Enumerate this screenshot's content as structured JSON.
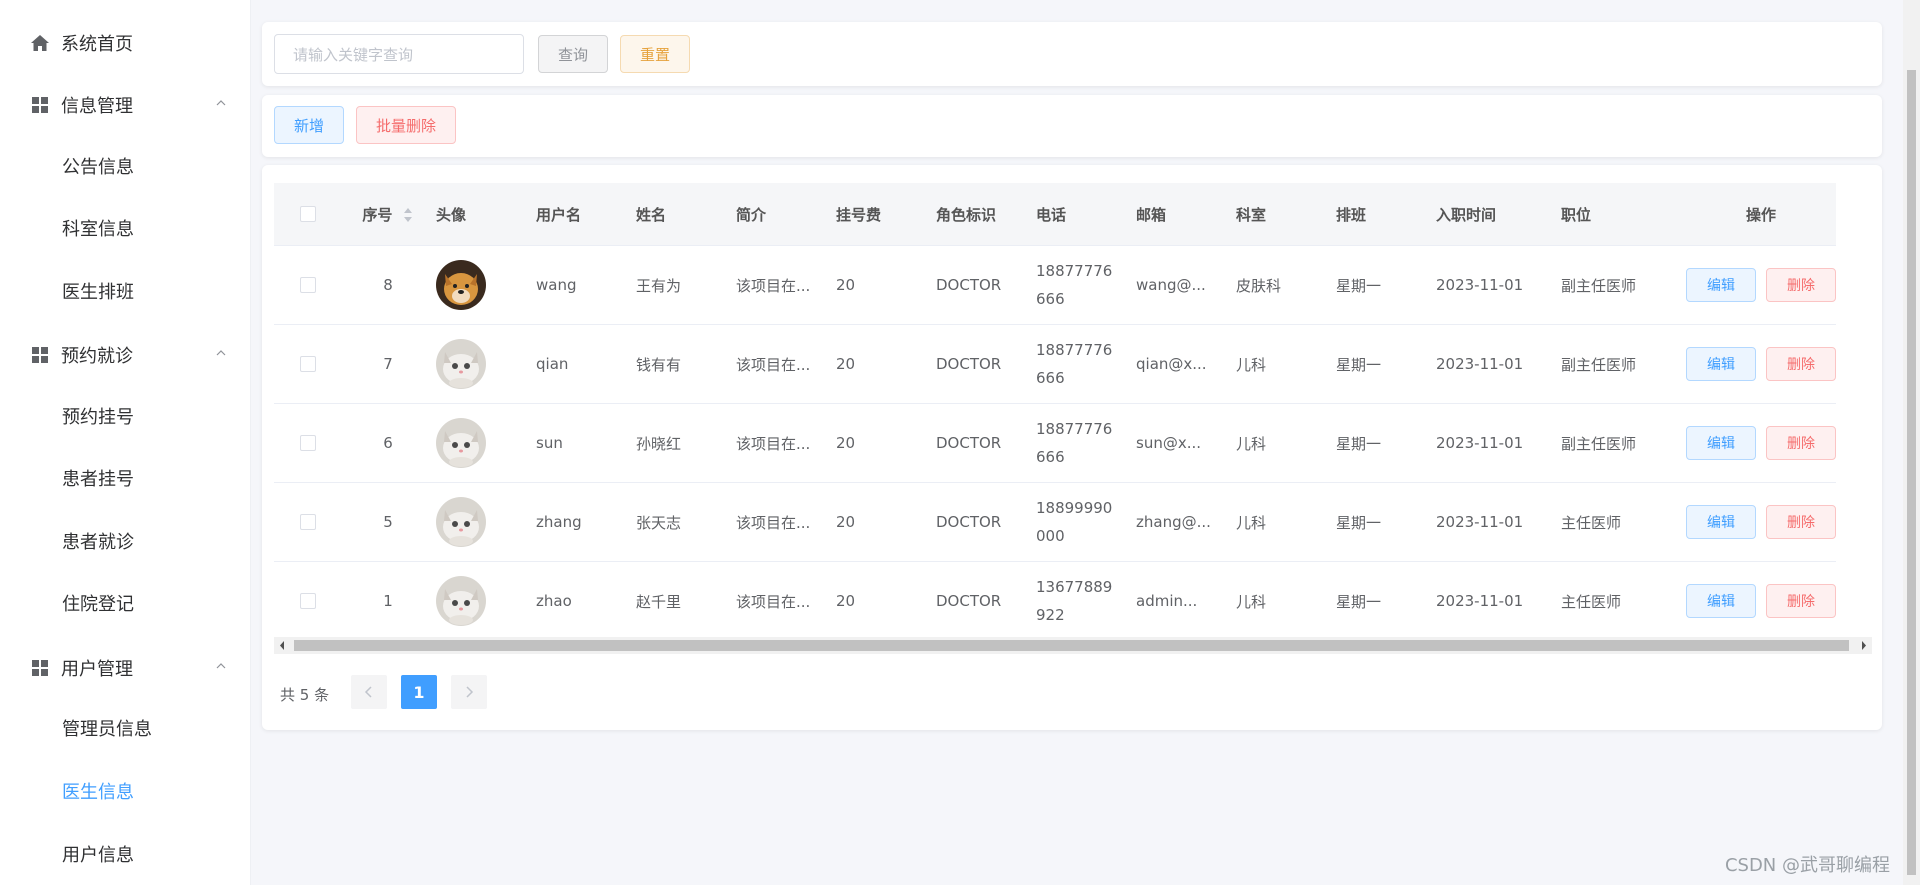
{
  "sidebar": {
    "home": "系统首页",
    "groups": [
      {
        "label": "信息管理",
        "items": [
          "公告信息",
          "科室信息",
          "医生排班"
        ]
      },
      {
        "label": "预约就诊",
        "items": [
          "预约挂号",
          "患者挂号",
          "患者就诊",
          "住院登记"
        ]
      },
      {
        "label": "用户管理",
        "items": [
          "管理员信息",
          "医生信息",
          "用户信息"
        ]
      }
    ],
    "active_item": "医生信息"
  },
  "search": {
    "placeholder": "请输入关键字查询",
    "query_label": "查询",
    "reset_label": "重置"
  },
  "actions": {
    "add_label": "新增",
    "batch_delete_label": "批量删除"
  },
  "table": {
    "headers": [
      "序号",
      "头像",
      "用户名",
      "姓名",
      "简介",
      "挂号费",
      "角色标识",
      "电话",
      "邮箱",
      "科室",
      "排班",
      "入职时间",
      "职位",
      "操作"
    ],
    "rows": [
      {
        "id": "8",
        "avatar": "dog",
        "username": "wang",
        "name": "王有为",
        "intro": "该项目在...",
        "fee": "20",
        "role": "DOCTOR",
        "phone1": "18877776",
        "phone2": "666",
        "email": "wang@...",
        "dept": "皮肤科",
        "schedule": "星期一",
        "date": "2023-11-01",
        "title": "副主任医师"
      },
      {
        "id": "7",
        "avatar": "cat",
        "username": "qian",
        "name": "钱有有",
        "intro": "该项目在...",
        "fee": "20",
        "role": "DOCTOR",
        "phone1": "18877776",
        "phone2": "666",
        "email": "qian@x...",
        "dept": "儿科",
        "schedule": "星期一",
        "date": "2023-11-01",
        "title": "副主任医师"
      },
      {
        "id": "6",
        "avatar": "cat",
        "username": "sun",
        "name": "孙晓红",
        "intro": "该项目在...",
        "fee": "20",
        "role": "DOCTOR",
        "phone1": "18877776",
        "phone2": "666",
        "email": "sun@x...",
        "dept": "儿科",
        "schedule": "星期一",
        "date": "2023-11-01",
        "title": "副主任医师"
      },
      {
        "id": "5",
        "avatar": "cat",
        "username": "zhang",
        "name": "张天志",
        "intro": "该项目在...",
        "fee": "20",
        "role": "DOCTOR",
        "phone1": "18899990",
        "phone2": "000",
        "email": "zhang@...",
        "dept": "儿科",
        "schedule": "星期一",
        "date": "2023-11-01",
        "title": "主任医师"
      },
      {
        "id": "1",
        "avatar": "cat",
        "username": "zhao",
        "name": "赵千里",
        "intro": "该项目在...",
        "fee": "20",
        "role": "DOCTOR",
        "phone1": "13677889",
        "phone2": "922",
        "email": "admin...",
        "dept": "儿科",
        "schedule": "星期一",
        "date": "2023-11-01",
        "title": "主任医师"
      }
    ],
    "edit_label": "编辑",
    "delete_label": "删除"
  },
  "pagination": {
    "total_text": "共 5 条",
    "current_page": "1"
  },
  "watermark": "CSDN @武哥聊编程",
  "colors": {
    "primary": "#409eff",
    "danger": "#f56c6c",
    "warning": "#e6a23c"
  }
}
